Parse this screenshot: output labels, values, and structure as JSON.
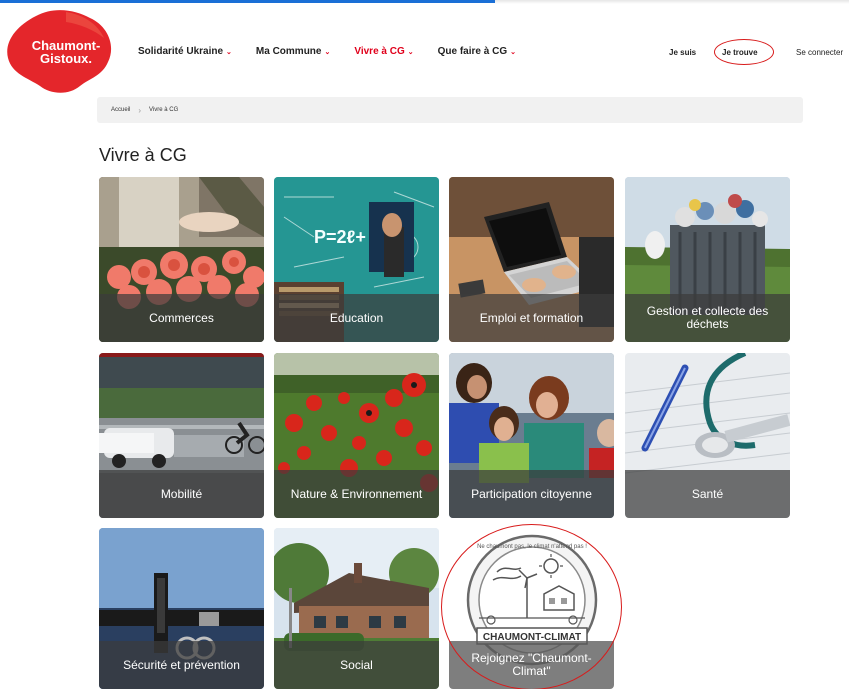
{
  "header": {
    "logo_line1": "Chaumont-",
    "logo_line2": "Gistoux.",
    "nav": [
      {
        "label": "Solidarité Ukraine",
        "active": false
      },
      {
        "label": "Ma Commune",
        "active": false
      },
      {
        "label": "Vivre à CG",
        "active": true
      },
      {
        "label": "Que faire à CG",
        "active": false
      }
    ],
    "je_suis": "Je suis",
    "je_trouve": "Je trouve",
    "se_connecter": "Se connecter"
  },
  "breadcrumb": {
    "home": "Accueil",
    "current": "Vivre à CG"
  },
  "page_title": "Vivre à CG",
  "tiles": [
    {
      "label": "Commerces",
      "icon": "roses-photo"
    },
    {
      "label": "Education",
      "icon": "blackboard-photo"
    },
    {
      "label": "Emploi et formation",
      "icon": "laptop-photo"
    },
    {
      "label": "Gestion et collecte des déchets",
      "icon": "garbage-bin-photo"
    },
    {
      "label": "Mobilité",
      "icon": "traffic-photo"
    },
    {
      "label": "Nature & Environnement",
      "icon": "poppies-photo"
    },
    {
      "label": "Participation citoyenne",
      "icon": "meeting-photo"
    },
    {
      "label": "Santé",
      "icon": "stethoscope-photo"
    },
    {
      "label": "Sécurité et prévention",
      "icon": "police-photo"
    },
    {
      "label": "Social",
      "icon": "building-photo"
    },
    {
      "label": "Rejoignez \"Chaumont-Climat\"",
      "icon": "climate-logo"
    }
  ],
  "climate_logo": {
    "arc_text": "Ne chaumont pas, le climat n'attend pas !",
    "banner": "CHAUMONT-CLIMAT"
  },
  "colors": {
    "brand_red": "#e0001b",
    "annotation_red": "#d81b1b"
  }
}
